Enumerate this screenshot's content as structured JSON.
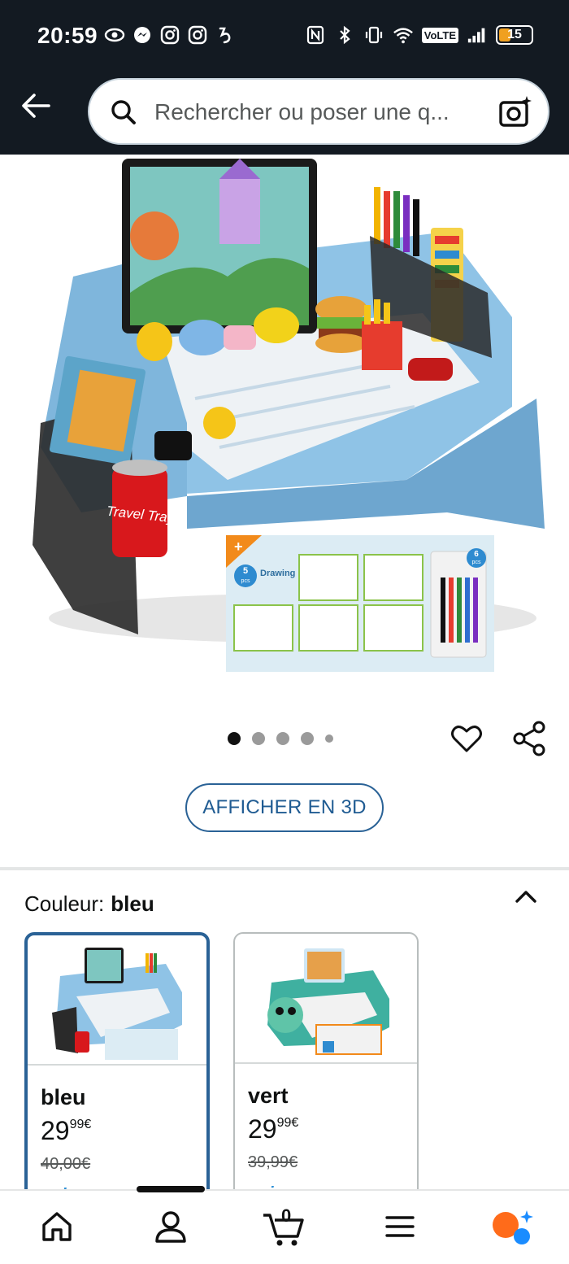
{
  "status_bar": {
    "time": "20:59",
    "left_icons": [
      "eye-icon",
      "messenger-icon",
      "instagram-icon",
      "instagram-icon",
      "app-icon"
    ],
    "right_icons": [
      "nfc-icon",
      "bluetooth-icon",
      "vibrate-icon",
      "wifi-icon",
      "volte-badge",
      "signal-icon",
      "battery-icon"
    ],
    "volte": "VoLTE",
    "battery_level": "15"
  },
  "search": {
    "placeholder": "Rechercher ou poser une q..."
  },
  "product": {
    "image_alt": "Travel Tray",
    "can_text": "Travel Tray",
    "drawing_pcs": "5",
    "drawing_pcs_unit": "pcs",
    "drawing_label": "Drawing Papers",
    "markers_pcs": "6",
    "markers_pcs_unit": "pcs",
    "plus_sign": "+",
    "carousel_dots": 5,
    "carousel_active_index": 0
  },
  "view_3d_label": "AFFICHER EN 3D",
  "color_selector": {
    "label": "Couleur:",
    "selected": "bleu",
    "variants": [
      {
        "name": "bleu",
        "price_whole": "29",
        "price_fraction": "99",
        "currency": "€",
        "old_price": "40,00€",
        "prime": "prime",
        "selected": true
      },
      {
        "name": "vert",
        "price_whole": "29",
        "price_fraction": "99",
        "currency": "€",
        "old_price": "39,99€",
        "prime": "prime",
        "selected": false
      }
    ]
  },
  "bottom_nav": {
    "items": [
      "home-icon",
      "account-icon",
      "cart-icon",
      "menu-icon",
      "rufus-icon"
    ],
    "cart_count": "0"
  },
  "colors": {
    "header_bg": "#131a22",
    "accent_blue": "#2a6296",
    "tray_blue": "#8fc3e6",
    "rufus_orange": "#ff6b1a",
    "rufus_blue": "#1a8cff"
  }
}
